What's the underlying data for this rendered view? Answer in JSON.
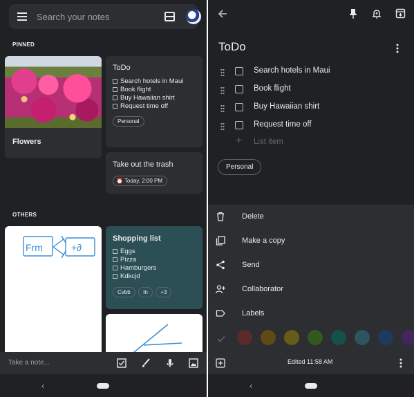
{
  "left": {
    "search_placeholder": "Search your notes",
    "pinned_label": "PINNED",
    "others_label": "OTHERS",
    "flowers_title": "Flowers",
    "todo_card": {
      "title": "ToDo",
      "items": [
        "Search hotels in Maui",
        "Book flight",
        "Buy Hawaiian shirt",
        "Request time off"
      ],
      "label": "Personal"
    },
    "trash_card": {
      "title": "Take out the trash",
      "reminder": "Today, 2:00 PM"
    },
    "drawing_text": [
      "Frm",
      "+∂"
    ],
    "shopping_card": {
      "title": "Shopping list",
      "items": [
        "Eggs",
        "Pizza",
        "Hamburgers",
        "Kdkcjd"
      ],
      "chips": [
        "Cvbb",
        "In",
        "+3"
      ]
    },
    "take_note_placeholder": "Take a note...",
    "colors": {
      "background": "#202124",
      "card": "#2d2e31",
      "teal_card": "#2b4f55"
    }
  },
  "right": {
    "note_title": "ToDo",
    "items": [
      "Search hotels in Maui",
      "Book flight",
      "Buy Hawaiian shirt",
      "Request time off"
    ],
    "list_item_placeholder": "List item",
    "label": "Personal",
    "menu": [
      "Delete",
      "Make a copy",
      "Send",
      "Collaborator",
      "Labels"
    ],
    "edited": "Edited 11:58 AM",
    "color_swatches": [
      "#5c2b29",
      "#614a19",
      "#635d19",
      "#345920",
      "#16504b",
      "#2d555e",
      "#1e3a5f",
      "#42275e"
    ]
  },
  "icons": [
    "menu-icon",
    "grid-view-icon",
    "avatar",
    "back-arrow-icon",
    "pin-icon",
    "reminder-bell-icon",
    "archive-icon",
    "more-vert-icon",
    "checkbox-icon",
    "brush-icon",
    "mic-icon",
    "image-icon",
    "trash-icon",
    "copy-icon",
    "share-icon",
    "person-add-icon",
    "label-icon",
    "add-box-icon",
    "check-icon",
    "alarm-icon"
  ]
}
